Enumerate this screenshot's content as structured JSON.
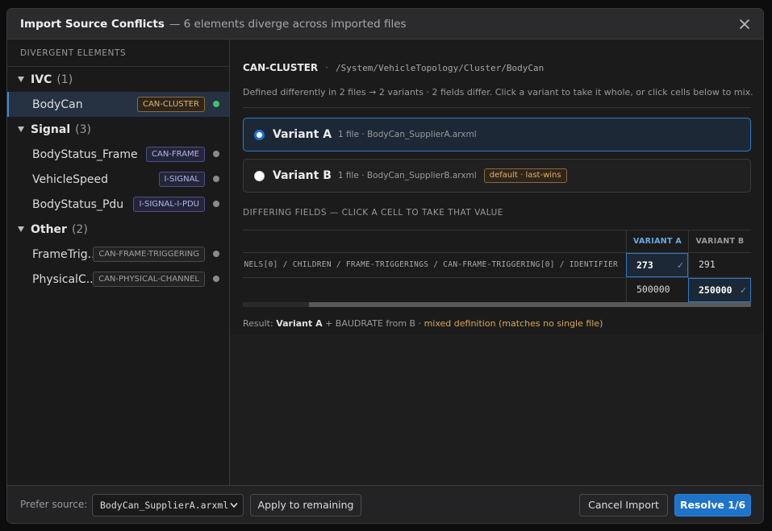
{
  "dialog": {
    "title": "Import Source Conflicts",
    "subtitle": "— 6 elements diverge across imported files",
    "close_icon": "close-icon"
  },
  "sidebar": {
    "heading": "DIVERGENT ELEMENTS",
    "groups": [
      {
        "name": "IVC",
        "count": "(1)",
        "items": [
          {
            "label": "BodyCan",
            "badge": "CAN-CLUSTER",
            "status": "resolved",
            "selected": true
          }
        ]
      },
      {
        "name": "Signal",
        "count": "(3)",
        "items": [
          {
            "label": "BodyStatus_Frame",
            "badge": "CAN-FRAME",
            "status": "pending"
          },
          {
            "label": "VehicleSpeed",
            "badge": "I-SIGNAL",
            "status": "pending"
          },
          {
            "label": "BodyStatus_Pdu",
            "badge": "I-SIGNAL-I-PDU",
            "status": "pending"
          }
        ]
      },
      {
        "name": "Other",
        "count": "(2)",
        "items": [
          {
            "label": "FrameTrig...",
            "badge": "CAN-FRAME-TRIGGERING",
            "status": "pending"
          },
          {
            "label": "PhysicalC...",
            "badge": "CAN-PHYSICAL-CHANNEL",
            "status": "pending"
          }
        ]
      }
    ]
  },
  "detail": {
    "element_name": "CAN-CLUSTER",
    "separator": "·",
    "path": "/System/VehicleTopology/Cluster/BodyCan",
    "description": "Defined differently in 2 files → 2 variants · 2 fields differ. Click a variant to take it whole, or click cells below to mix.",
    "variants": [
      {
        "name": "Variant A",
        "meta": "1 file · BodyCan_SupplierA.arxml",
        "checked": true,
        "badge": ""
      },
      {
        "name": "Variant B",
        "meta": "1 file · BodyCan_SupplierB.arxml",
        "checked": false,
        "badge": "default · last-wins"
      }
    ],
    "fields_heading": "DIFFERING FIELDS — CLICK A CELL TO TAKE THAT VALUE",
    "columns": {
      "a": "VARIANT A",
      "b": "VARIANT B"
    },
    "rows": [
      {
        "path": "NELS[0] / CHILDREN / FRAME-TRIGGERINGS / CAN-FRAME-TRIGGERING[0] / IDENTIFIER",
        "a": "273",
        "b": "291",
        "chosen": "a"
      },
      {
        "path": "",
        "a": "500000",
        "b": "250000",
        "chosen": "b"
      }
    ],
    "result": {
      "label": "Result:",
      "variant": "Variant A",
      "mix": "+ BAUDRATE from B ·",
      "warning": "mixed definition (matches no single file)"
    }
  },
  "footer": {
    "prefer_label": "Prefer source:",
    "prefer_value": "BodyCan_SupplierA.arxml",
    "apply_label": "Apply to remaining",
    "cancel_label": "Cancel Import",
    "resolve_label": "Resolve 1/6"
  },
  "colors": {
    "accent": "#1f73c8",
    "resolved": "#3ec26a",
    "warning": "#d8a84e"
  }
}
